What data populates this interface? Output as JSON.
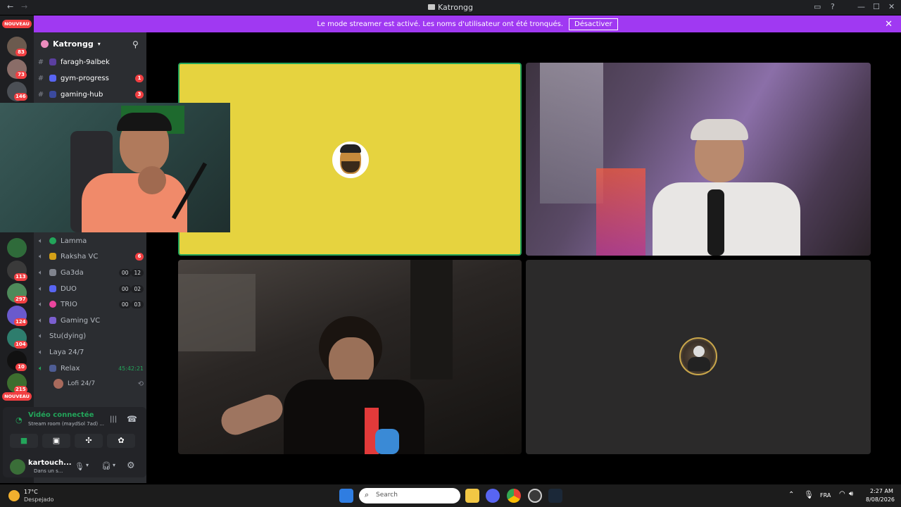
{
  "window": {
    "title": "Katrongg"
  },
  "banner": {
    "text": "Le mode streamer est activé. Les noms d'utilisateur ont été tronqués.",
    "button": "Désactiver"
  },
  "server": {
    "name": "Katrongg"
  },
  "guild_badges": [
    "NOUVEAU",
    "83",
    "73",
    "146",
    "113",
    "297",
    "124",
    "104",
    "10",
    "215",
    "NOUVEAU"
  ],
  "text_channels": [
    {
      "name": "faragh-9albek",
      "badge": ""
    },
    {
      "name": "gym-progress",
      "badge": "1"
    },
    {
      "name": "gaming-hub",
      "badge": "3"
    }
  ],
  "voice_channels": [
    {
      "name": "Lamma",
      "count_a": "",
      "count_b": "",
      "badge": ""
    },
    {
      "name": "Raksha VC",
      "count_a": "",
      "count_b": "",
      "badge": "6"
    },
    {
      "name": "Ga3da",
      "count_a": "00",
      "count_b": "12",
      "badge": ""
    },
    {
      "name": "DUO",
      "count_a": "00",
      "count_b": "02",
      "badge": ""
    },
    {
      "name": "TRIO",
      "count_a": "00",
      "count_b": "03",
      "badge": ""
    },
    {
      "name": "Gaming VC",
      "count_a": "",
      "count_b": "",
      "badge": ""
    },
    {
      "name": "Stu(dying)",
      "count_a": "",
      "count_b": "",
      "badge": ""
    },
    {
      "name": "Laya 24/7",
      "count_a": "",
      "count_b": "",
      "badge": ""
    },
    {
      "name": "Relax",
      "count_a": "45:42:21",
      "count_b": "",
      "badge": ""
    }
  ],
  "voice_member": {
    "name": "Lofi 24/7"
  },
  "voice_status": {
    "title": "Vidéo connectée",
    "subtitle": "Stream room (maydSol 7ad) ..."
  },
  "user": {
    "name": "kartouch...",
    "status": "Dans un s..."
  },
  "taskbar": {
    "weather_temp": "17°C",
    "weather_desc": "Despejado",
    "search_placeholder": "Search",
    "lang": "FRA",
    "time": "2:27 AM",
    "date": "8/08/2026"
  },
  "colors": {
    "banner": "#a039f2",
    "yellow_tile": "#e6d33f",
    "accent_green": "#23a55a",
    "badge_red": "#f23f42"
  }
}
